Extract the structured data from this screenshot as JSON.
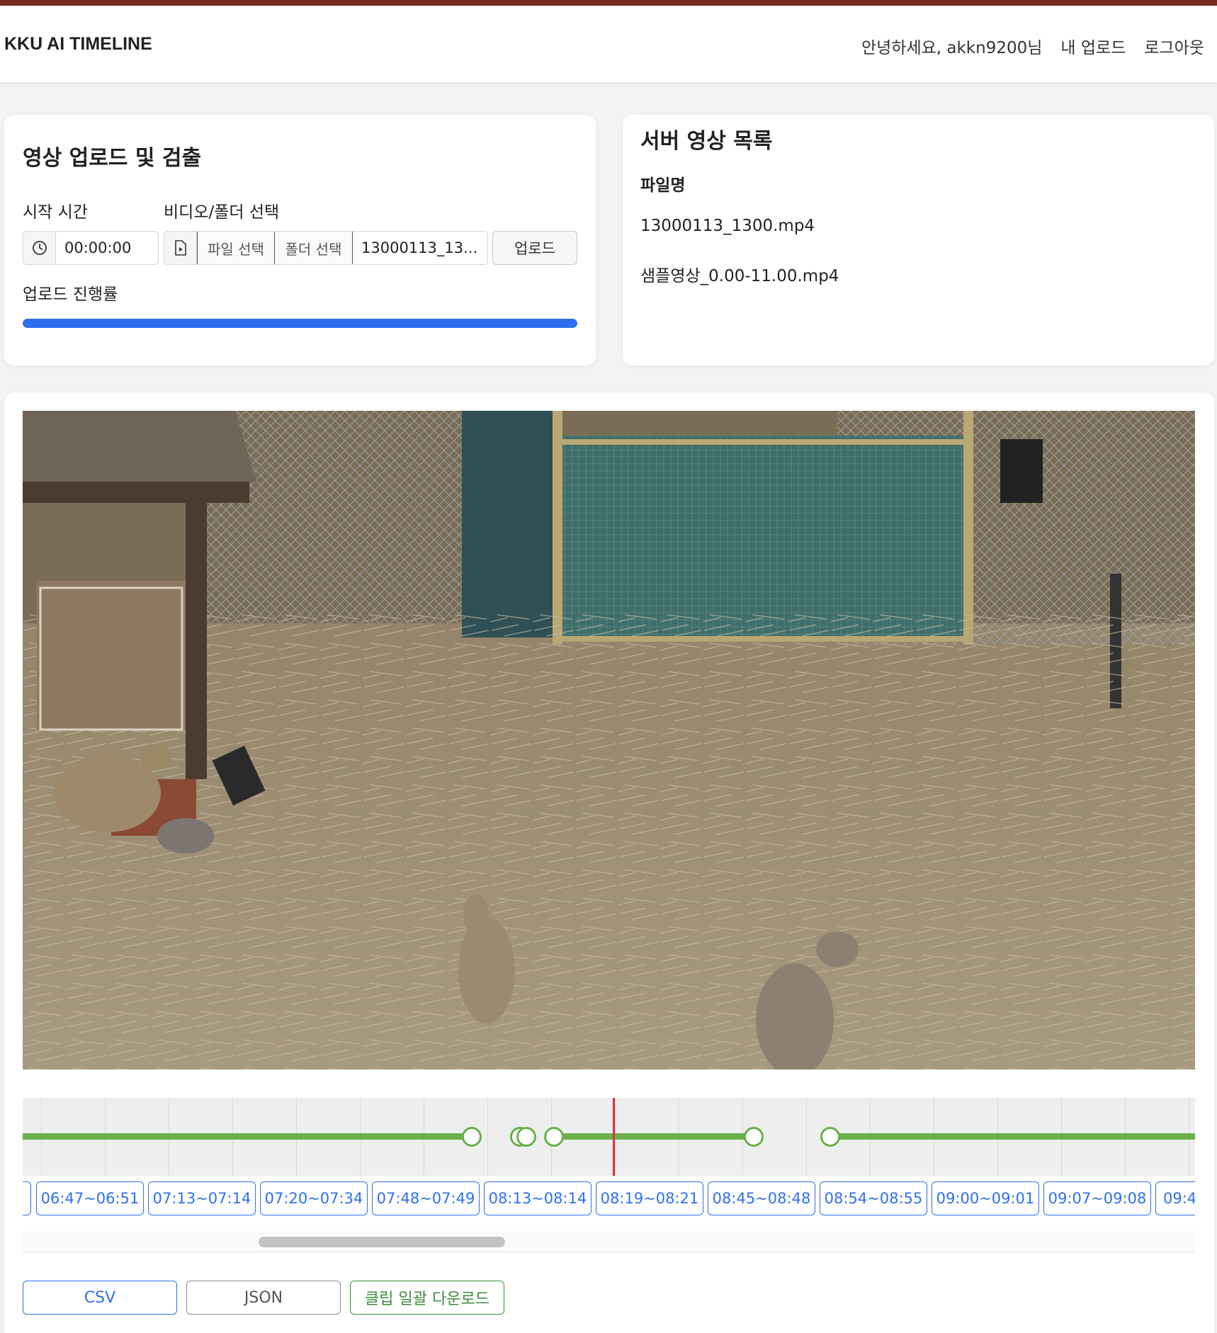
{
  "app": {
    "brand": "KKU AI TIMELINE"
  },
  "nav": {
    "greeting": "안녕하세요, akkn9200님",
    "my_uploads": "내 업로드",
    "logout": "로그아웃"
  },
  "upload": {
    "title": "영상 업로드 및 검출",
    "start_time_label": "시작 시간",
    "start_time_value": "00:00:00",
    "video_select_label": "비디오/폴더 선택",
    "file_select_button": "파일 선택",
    "folder_select_button": "폴더 선택",
    "selected_file": "13000113_13...",
    "upload_button": "업로드",
    "progress_label": "업로드 진행률",
    "progress_percent": 100
  },
  "server_list": {
    "title": "서버 영상 목록",
    "column_header": "파일명",
    "files": [
      "13000113_1300.mp4",
      "샘플영상_0.00-11.00.mp4"
    ]
  },
  "player": {
    "timeline_accent": "#6ab04c",
    "cursor_color": "#d9363e"
  },
  "clips": [
    "",
    "06:47~06:51",
    "07:13~07:14",
    "07:20~07:34",
    "07:48~07:49",
    "08:13~08:14",
    "08:19~08:21",
    "08:45~08:48",
    "08:54~08:55",
    "09:00~09:01",
    "09:07~09:08",
    "09:4"
  ],
  "export": {
    "csv": "CSV",
    "json": "JSON",
    "bulk_download": "클립 일괄 다운로드"
  },
  "colors": {
    "primary": "#2f6fed",
    "success": "#3a8d3a",
    "header_accent": "#7a2a1e"
  },
  "icons": {
    "clock": "clock-icon",
    "file": "file-video-icon"
  }
}
